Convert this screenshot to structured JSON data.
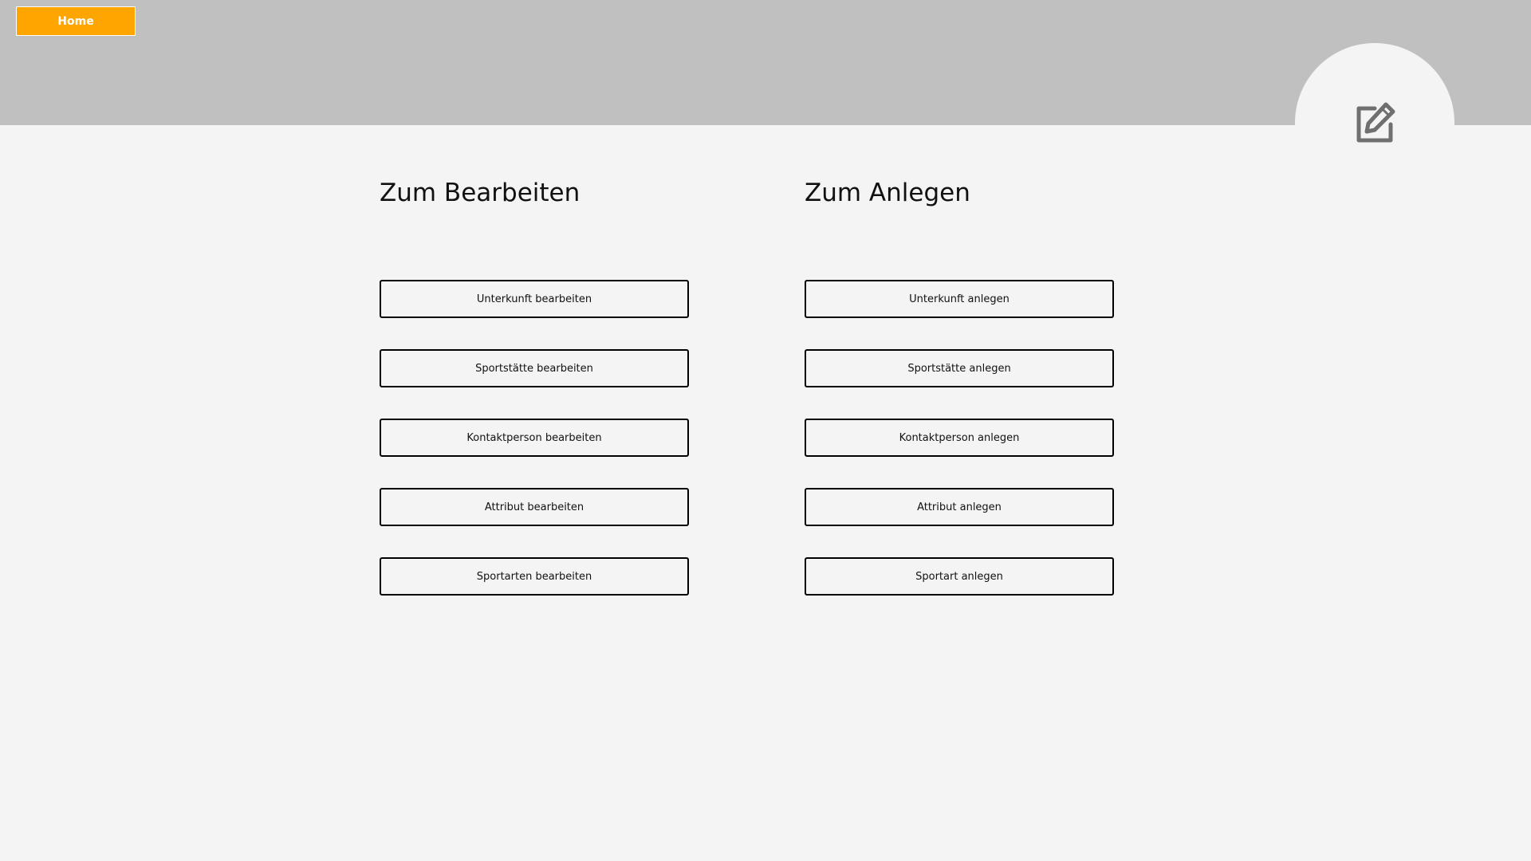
{
  "header": {
    "home_label": "Home",
    "edit_icon": "edit-icon"
  },
  "columns": {
    "edit": {
      "title": "Zum Bearbeiten",
      "buttons": [
        "Unterkunft bearbeiten",
        "Sportstätte bearbeiten",
        "Kontaktperson bearbeiten",
        "Attribut bearbeiten",
        "Sportarten bearbeiten"
      ]
    },
    "create": {
      "title": "Zum Anlegen",
      "buttons": [
        "Unterkunft anlegen",
        "Sportstätte anlegen",
        "Kontaktperson anlegen",
        "Attribut anlegen",
        "Sportart anlegen"
      ]
    }
  },
  "colors": {
    "accent": "#ffa500",
    "header_bg": "#c0c0c0",
    "page_bg": "#f4f4f4",
    "icon": "#6f6f6f"
  }
}
